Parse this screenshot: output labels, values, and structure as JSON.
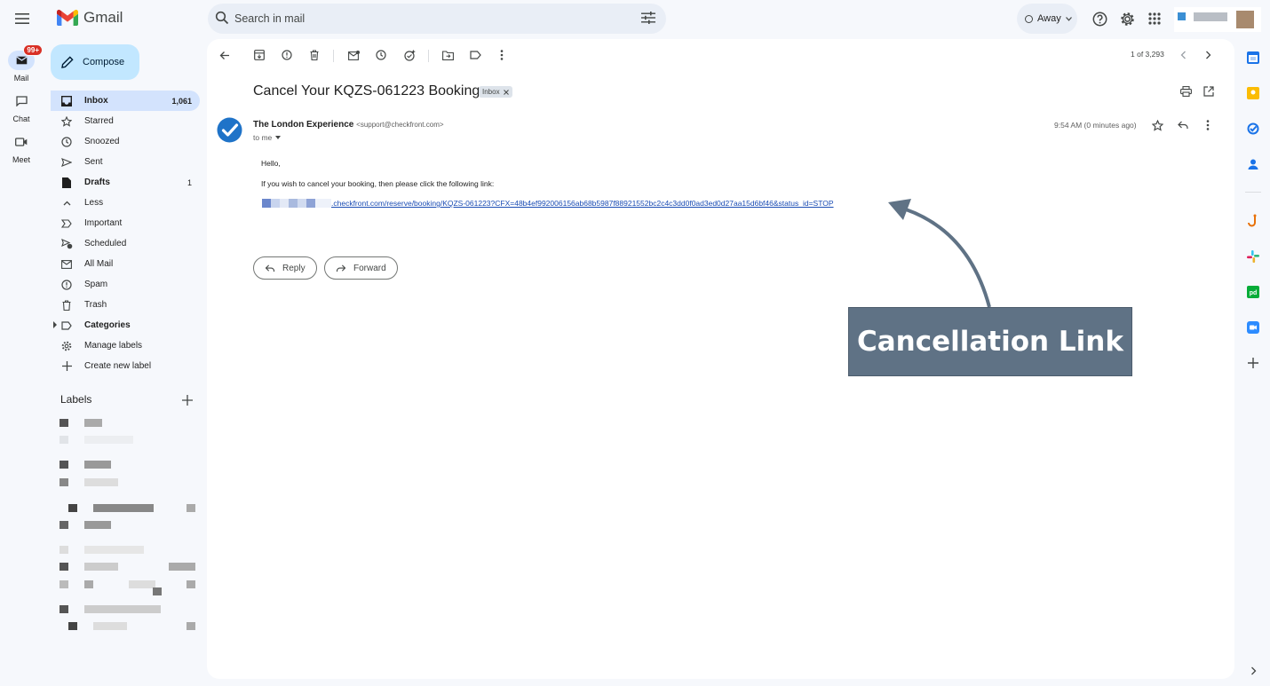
{
  "app": {
    "name": "Gmail"
  },
  "search": {
    "placeholder": "Search in mail"
  },
  "status": {
    "label": "Away"
  },
  "rail": [
    {
      "label": "Mail",
      "badge": "99+",
      "icon": "mail-icon"
    },
    {
      "label": "Chat",
      "icon": "chat-icon"
    },
    {
      "label": "Meet",
      "icon": "video-icon"
    }
  ],
  "compose": {
    "label": "Compose"
  },
  "nav": {
    "inbox": {
      "label": "Inbox",
      "count": "1,061"
    },
    "starred": {
      "label": "Starred"
    },
    "snoozed": {
      "label": "Snoozed"
    },
    "sent": {
      "label": "Sent"
    },
    "drafts": {
      "label": "Drafts",
      "count": "1"
    },
    "less": {
      "label": "Less"
    },
    "important": {
      "label": "Important"
    },
    "scheduled": {
      "label": "Scheduled"
    },
    "allmail": {
      "label": "All Mail"
    },
    "spam": {
      "label": "Spam"
    },
    "trash": {
      "label": "Trash"
    },
    "categories": {
      "label": "Categories"
    },
    "manage": {
      "label": "Manage labels"
    },
    "create": {
      "label": "Create new label"
    }
  },
  "labels": {
    "heading": "Labels"
  },
  "toolbar": {
    "pager": "1 of 3,293"
  },
  "email": {
    "subject": "Cancel Your KQZS-061223 Booking",
    "folder_chip": "Inbox",
    "sender_name": "The London Experience",
    "sender_email": "<support@checkfront.com>",
    "recipient": "to me",
    "time": "9:54 AM (0 minutes ago)",
    "greeting": "Hello,",
    "line1": "If you wish to cancel your booking, then please click the following link:",
    "link_text": ".checkfront.com/reserve/booking/KQZS-061223?CFX=48b4ef992006156ab68b5987f88921552bc2c4c3dd0f0ad3ed0d27aa15d6bf46&status_id=STOP"
  },
  "actions": {
    "reply": "Reply",
    "forward": "Forward"
  },
  "annotation": {
    "label": "Cancellation Link",
    "color": "#5f7285"
  },
  "colors": {
    "accent": "#0b57d0",
    "selected": "#d3e3fd",
    "compose": "#c2e7ff",
    "link": "#1a4cb4"
  }
}
